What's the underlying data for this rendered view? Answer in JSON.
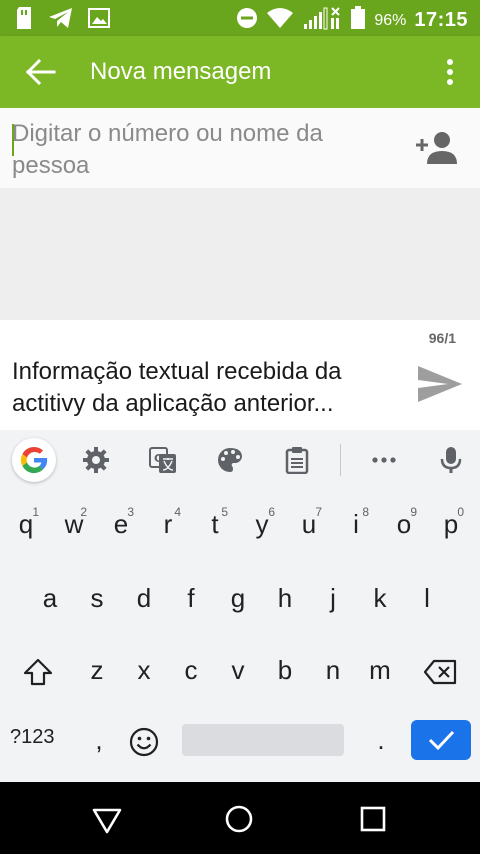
{
  "status_bar": {
    "battery_percent": "96%",
    "time": "17:15",
    "icons_left": [
      "sim-card-icon",
      "telegram-icon",
      "image-icon"
    ],
    "icons_right": [
      "do-not-disturb-icon",
      "wifi-icon",
      "signal-icon",
      "battery-icon"
    ]
  },
  "app_bar": {
    "title": "Nova mensagem",
    "background": "#7cb726",
    "icons": [
      "arrow-back-icon",
      "more-vert-icon"
    ]
  },
  "recipient": {
    "placeholder": "Digitar o número ou nome da pessoa",
    "icon": "person-add-icon"
  },
  "compose": {
    "char_counter": "96/1",
    "message": "Informação textual recebida da actitivy da aplicação anterior...",
    "icon": "send-icon"
  },
  "keyboard": {
    "toolbar_icons": [
      "google-icon",
      "gear-icon",
      "translate-icon",
      "palette-icon",
      "clipboard-icon",
      "more-icon",
      "mic-icon"
    ],
    "row1": [
      {
        "label": "q",
        "hint": "1"
      },
      {
        "label": "w",
        "hint": "2"
      },
      {
        "label": "e",
        "hint": "3"
      },
      {
        "label": "r",
        "hint": "4"
      },
      {
        "label": "t",
        "hint": "5"
      },
      {
        "label": "y",
        "hint": "6"
      },
      {
        "label": "u",
        "hint": "7"
      },
      {
        "label": "i",
        "hint": "8"
      },
      {
        "label": "o",
        "hint": "9"
      },
      {
        "label": "p",
        "hint": "0"
      }
    ],
    "row2": [
      "a",
      "s",
      "d",
      "f",
      "g",
      "h",
      "j",
      "k",
      "l"
    ],
    "row3": [
      "z",
      "x",
      "c",
      "v",
      "b",
      "n",
      "m"
    ],
    "symbols_label": "?123",
    "comma_label": ",",
    "period_label": ".",
    "accent": "#1a73e8"
  },
  "nav_bar": {
    "icons": [
      "back-triangle-icon",
      "home-circle-icon",
      "recents-square-icon"
    ]
  }
}
